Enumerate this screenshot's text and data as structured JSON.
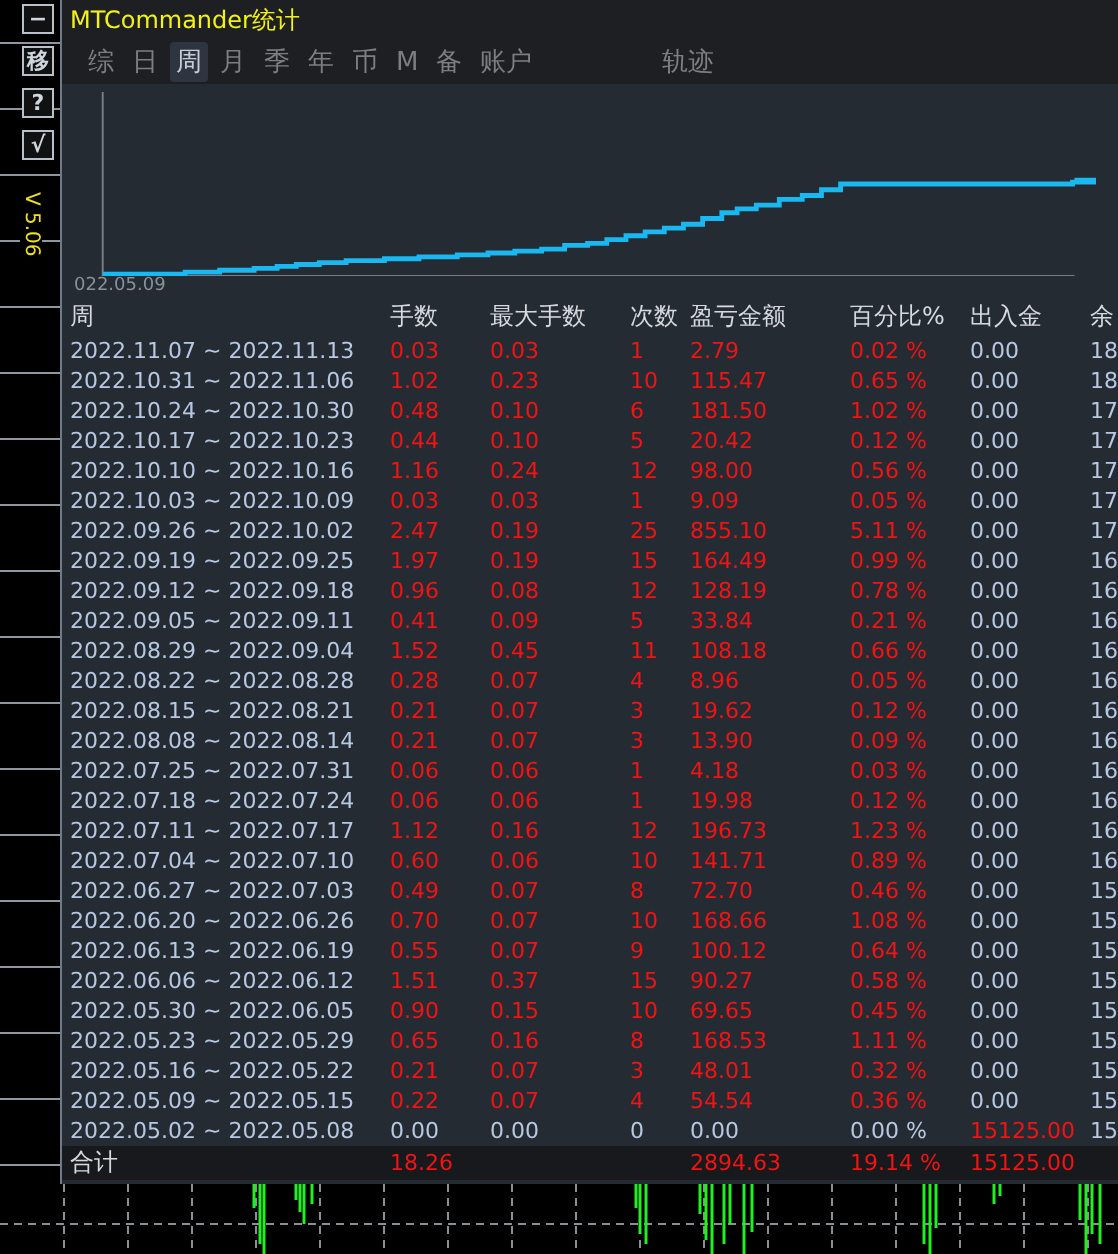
{
  "sidebar": {
    "buttons": [
      {
        "label": "−"
      },
      {
        "label": "移"
      },
      {
        "label": "?"
      },
      {
        "label": "√"
      }
    ],
    "version": "V 5.06"
  },
  "window": {
    "title": "MTCommander统计"
  },
  "tabs": [
    {
      "label": "综",
      "selected": false
    },
    {
      "label": "日",
      "selected": false
    },
    {
      "label": "周",
      "selected": true
    },
    {
      "label": "月",
      "selected": false
    },
    {
      "label": "季",
      "selected": false
    },
    {
      "label": "年",
      "selected": false
    },
    {
      "label": "币",
      "selected": false
    },
    {
      "label": "M",
      "selected": false
    },
    {
      "label": "备",
      "selected": false
    },
    {
      "label": "账户",
      "selected": false
    },
    {
      "label": "轨迹",
      "selected": false
    }
  ],
  "chart": {
    "x_label": "022.05.09"
  },
  "table": {
    "columns": [
      "周",
      "手数",
      "最大手数",
      "次数",
      "盈亏金额",
      "百分比%",
      "出入金",
      "余"
    ],
    "rows": [
      {
        "cells": [
          "2022.11.07 ~ 2022.11.13",
          "0.03",
          "0.03",
          "1",
          "2.79",
          "0.02 %",
          "0.00",
          "18"
        ],
        "traded": true,
        "deposit": false
      },
      {
        "cells": [
          "2022.10.31 ~ 2022.11.06",
          "1.02",
          "0.23",
          "10",
          "115.47",
          "0.65 %",
          "0.00",
          "18"
        ],
        "traded": true,
        "deposit": false
      },
      {
        "cells": [
          "2022.10.24 ~ 2022.10.30",
          "0.48",
          "0.10",
          "6",
          "181.50",
          "1.02 %",
          "0.00",
          "17"
        ],
        "traded": true,
        "deposit": false
      },
      {
        "cells": [
          "2022.10.17 ~ 2022.10.23",
          "0.44",
          "0.10",
          "5",
          "20.42",
          "0.12 %",
          "0.00",
          "17"
        ],
        "traded": true,
        "deposit": false
      },
      {
        "cells": [
          "2022.10.10 ~ 2022.10.16",
          "1.16",
          "0.24",
          "12",
          "98.00",
          "0.56 %",
          "0.00",
          "17"
        ],
        "traded": true,
        "deposit": false
      },
      {
        "cells": [
          "2022.10.03 ~ 2022.10.09",
          "0.03",
          "0.03",
          "1",
          "9.09",
          "0.05 %",
          "0.00",
          "17"
        ],
        "traded": true,
        "deposit": false
      },
      {
        "cells": [
          "2022.09.26 ~ 2022.10.02",
          "2.47",
          "0.19",
          "25",
          "855.10",
          "5.11 %",
          "0.00",
          "17"
        ],
        "traded": true,
        "deposit": false
      },
      {
        "cells": [
          "2022.09.19 ~ 2022.09.25",
          "1.97",
          "0.19",
          "15",
          "164.49",
          "0.99 %",
          "0.00",
          "16"
        ],
        "traded": true,
        "deposit": false
      },
      {
        "cells": [
          "2022.09.12 ~ 2022.09.18",
          "0.96",
          "0.08",
          "12",
          "128.19",
          "0.78 %",
          "0.00",
          "16"
        ],
        "traded": true,
        "deposit": false
      },
      {
        "cells": [
          "2022.09.05 ~ 2022.09.11",
          "0.41",
          "0.09",
          "5",
          "33.84",
          "0.21 %",
          "0.00",
          "16"
        ],
        "traded": true,
        "deposit": false
      },
      {
        "cells": [
          "2022.08.29 ~ 2022.09.04",
          "1.52",
          "0.45",
          "11",
          "108.18",
          "0.66 %",
          "0.00",
          "16"
        ],
        "traded": true,
        "deposit": false
      },
      {
        "cells": [
          "2022.08.22 ~ 2022.08.28",
          "0.28",
          "0.07",
          "4",
          "8.96",
          "0.05 %",
          "0.00",
          "16"
        ],
        "traded": true,
        "deposit": false
      },
      {
        "cells": [
          "2022.08.15 ~ 2022.08.21",
          "0.21",
          "0.07",
          "3",
          "19.62",
          "0.12 %",
          "0.00",
          "16"
        ],
        "traded": true,
        "deposit": false
      },
      {
        "cells": [
          "2022.08.08 ~ 2022.08.14",
          "0.21",
          "0.07",
          "3",
          "13.90",
          "0.09 %",
          "0.00",
          "16"
        ],
        "traded": true,
        "deposit": false
      },
      {
        "cells": [
          "2022.07.25 ~ 2022.07.31",
          "0.06",
          "0.06",
          "1",
          "4.18",
          "0.03 %",
          "0.00",
          "16"
        ],
        "traded": true,
        "deposit": false
      },
      {
        "cells": [
          "2022.07.18 ~ 2022.07.24",
          "0.06",
          "0.06",
          "1",
          "19.98",
          "0.12 %",
          "0.00",
          "16"
        ],
        "traded": true,
        "deposit": false
      },
      {
        "cells": [
          "2022.07.11 ~ 2022.07.17",
          "1.12",
          "0.16",
          "12",
          "196.73",
          "1.23 %",
          "0.00",
          "16"
        ],
        "traded": true,
        "deposit": false
      },
      {
        "cells": [
          "2022.07.04 ~ 2022.07.10",
          "0.60",
          "0.06",
          "10",
          "141.71",
          "0.89 %",
          "0.00",
          "16"
        ],
        "traded": true,
        "deposit": false
      },
      {
        "cells": [
          "2022.06.27 ~ 2022.07.03",
          "0.49",
          "0.07",
          "8",
          "72.70",
          "0.46 %",
          "0.00",
          "15"
        ],
        "traded": true,
        "deposit": false
      },
      {
        "cells": [
          "2022.06.20 ~ 2022.06.26",
          "0.70",
          "0.07",
          "10",
          "168.66",
          "1.08 %",
          "0.00",
          "15"
        ],
        "traded": true,
        "deposit": false
      },
      {
        "cells": [
          "2022.06.13 ~ 2022.06.19",
          "0.55",
          "0.07",
          "9",
          "100.12",
          "0.64 %",
          "0.00",
          "15"
        ],
        "traded": true,
        "deposit": false
      },
      {
        "cells": [
          "2022.06.06 ~ 2022.06.12",
          "1.51",
          "0.37",
          "15",
          "90.27",
          "0.58 %",
          "0.00",
          "15"
        ],
        "traded": true,
        "deposit": false
      },
      {
        "cells": [
          "2022.05.30 ~ 2022.06.05",
          "0.90",
          "0.15",
          "10",
          "69.65",
          "0.45 %",
          "0.00",
          "15"
        ],
        "traded": true,
        "deposit": false
      },
      {
        "cells": [
          "2022.05.23 ~ 2022.05.29",
          "0.65",
          "0.16",
          "8",
          "168.53",
          "1.11 %",
          "0.00",
          "15"
        ],
        "traded": true,
        "deposit": false
      },
      {
        "cells": [
          "2022.05.16 ~ 2022.05.22",
          "0.21",
          "0.07",
          "3",
          "48.01",
          "0.32 %",
          "0.00",
          "15"
        ],
        "traded": true,
        "deposit": false
      },
      {
        "cells": [
          "2022.05.09 ~ 2022.05.15",
          "0.22",
          "0.07",
          "4",
          "54.54",
          "0.36 %",
          "0.00",
          "15"
        ],
        "traded": true,
        "deposit": false
      },
      {
        "cells": [
          "2022.05.02 ~ 2022.05.08",
          "0.00",
          "0.00",
          "0",
          "0.00",
          "0.00 %",
          "15125.00",
          "15"
        ],
        "traded": false,
        "deposit": true
      }
    ],
    "total": {
      "label": "合计",
      "lots": "18.26",
      "profit": "2894.63",
      "percent": "19.14 %",
      "deposit": "15125.00"
    }
  }
}
